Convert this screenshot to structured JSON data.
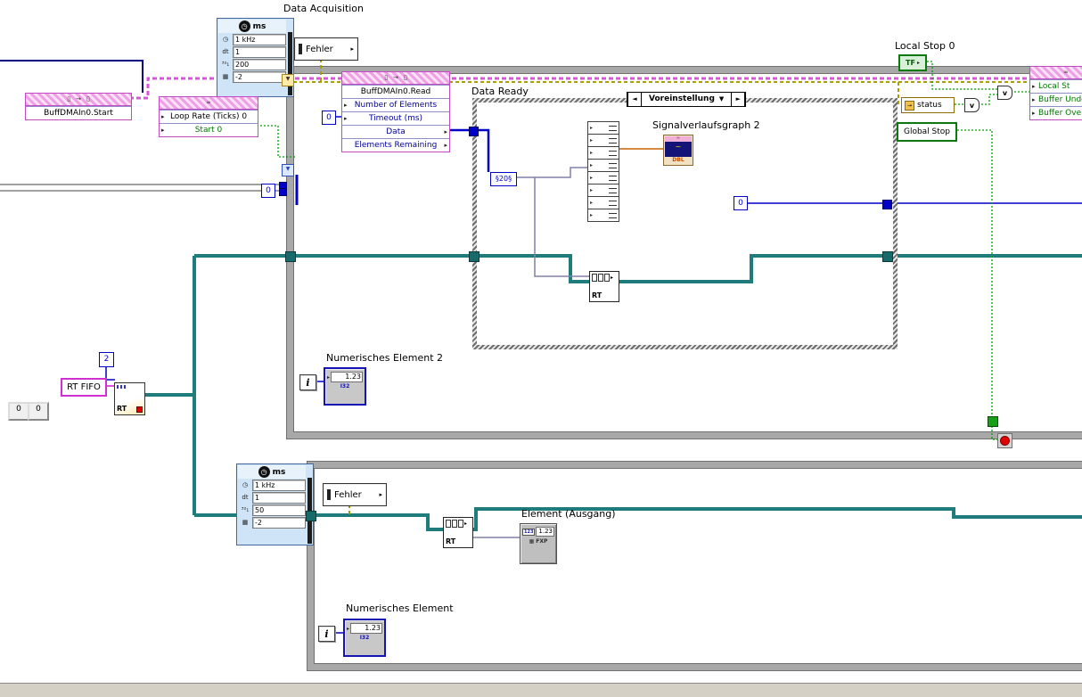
{
  "labels": {
    "data_acquisition": "Data Acquisition",
    "data_ready": "Data Ready",
    "signal_graph": "Signalverlaufsgraph 2",
    "numeric_element_2": "Numerisches Element 2",
    "numeric_element": "Numerisches Element",
    "element_output": "Element (Ausgang)",
    "local_stop_0": "Local Stop 0",
    "rt_fifo": "RT FIFO"
  },
  "timing1": {
    "unit": "ms",
    "source": "1 kHz",
    "dt_label": "dt",
    "dt_value": "1",
    "offset": "200",
    "priority": "-2"
  },
  "timing2": {
    "unit": "ms",
    "source": "1 kHz",
    "dt_label": "dt",
    "dt_value": "1",
    "offset": "50",
    "priority": "-2"
  },
  "dma_start": {
    "title": "BuffDMAIn0.Start"
  },
  "loop_rate": {
    "row1": "Loop Rate (Ticks) 0",
    "row2": "Start 0"
  },
  "dma_read": {
    "title": "BuffDMAIn0.Read",
    "in1": "Number of Elements",
    "in2": "Timeout (ms)",
    "out1": "Data",
    "out2": "Elements Remaining"
  },
  "case_structure": {
    "selector": "Voreinstellung"
  },
  "right_node": {
    "row1": "Local St",
    "row2": "Buffer Unde",
    "row3": "Buffer Ove"
  },
  "indicators": {
    "fehler": "Fehler",
    "status": "status",
    "global_stop": "Global Stop",
    "tf": "TF"
  },
  "fifo": {
    "rt": "RT"
  },
  "constants": {
    "two": "2",
    "zero": "0",
    "subset": "§20§"
  },
  "numeric": {
    "display": "1.23",
    "badge": "123",
    "type_fxp": "FXP",
    "type_i32": "I32",
    "type_dbl": "DBL"
  },
  "misc": {
    "iteration": "i",
    "or": "v"
  },
  "icons": {
    "clock": "◷",
    "i32_rep": "³²₁",
    "grid": "▦",
    "glasses": "∞",
    "page": "▯",
    "arrow": "→",
    "pointer_right": "▸",
    "tri_down": "▼",
    "sel_left": "◄",
    "sel_right": "►",
    "wave": "≈",
    "trace": "~"
  },
  "colors": {
    "teal_wire": "#1f7c7c",
    "pink_wire": "#e050e0",
    "green_wire": "#00a000",
    "error_wire": "#a8a000",
    "blue_wire": "#0000c8",
    "loop_border": "#a8a8a8"
  }
}
